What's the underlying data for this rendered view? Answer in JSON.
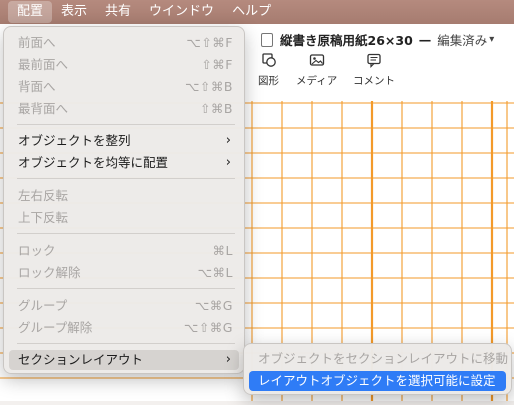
{
  "menubar": {
    "items": [
      "配置",
      "表示",
      "共有",
      "ウインドウ",
      "ヘルプ"
    ]
  },
  "document": {
    "title": "縦書き原稿用紙26×30",
    "separator": "—",
    "status": "編集済み"
  },
  "toolbar": {
    "buttons": [
      {
        "label": "図形",
        "icon": "shape-icon"
      },
      {
        "label": "メディア",
        "icon": "media-icon"
      },
      {
        "label": "コメント",
        "icon": "comment-icon"
      }
    ]
  },
  "colors": {
    "grid": "#f39a2a",
    "menubar": "#a67c70",
    "selection": "#2f7cf6"
  },
  "menu": {
    "items": [
      {
        "label": "前面へ",
        "shortcut": "⌥⇧⌘F",
        "enabled": false
      },
      {
        "label": "最前面へ",
        "shortcut": "⇧⌘F",
        "enabled": false
      },
      {
        "label": "背面へ",
        "shortcut": "⌥⇧⌘B",
        "enabled": false
      },
      {
        "label": "最背面へ",
        "shortcut": "⇧⌘B",
        "enabled": false
      },
      {
        "label": "オブジェクトを整列",
        "submenu": true,
        "enabled": true
      },
      {
        "label": "オブジェクトを均等に配置",
        "submenu": true,
        "enabled": true
      },
      {
        "label": "左右反転",
        "enabled": false
      },
      {
        "label": "上下反転",
        "enabled": false
      },
      {
        "label": "ロック",
        "shortcut": "⌘L",
        "enabled": false
      },
      {
        "label": "ロック解除",
        "shortcut": "⌥⌘L",
        "enabled": false
      },
      {
        "label": "グループ",
        "shortcut": "⌥⌘G",
        "enabled": false
      },
      {
        "label": "グループ解除",
        "shortcut": "⌥⇧⌘G",
        "enabled": false
      },
      {
        "label": "セクションレイアウト",
        "submenu": true,
        "enabled": true,
        "highlighted": true
      }
    ],
    "arrow": "›"
  },
  "submenu": {
    "items": [
      {
        "label": "オブジェクトをセクションレイアウトに移動",
        "enabled": false
      },
      {
        "label": "レイアウトオブジェクトを選択可能に設定",
        "enabled": true,
        "selected": true
      }
    ]
  }
}
